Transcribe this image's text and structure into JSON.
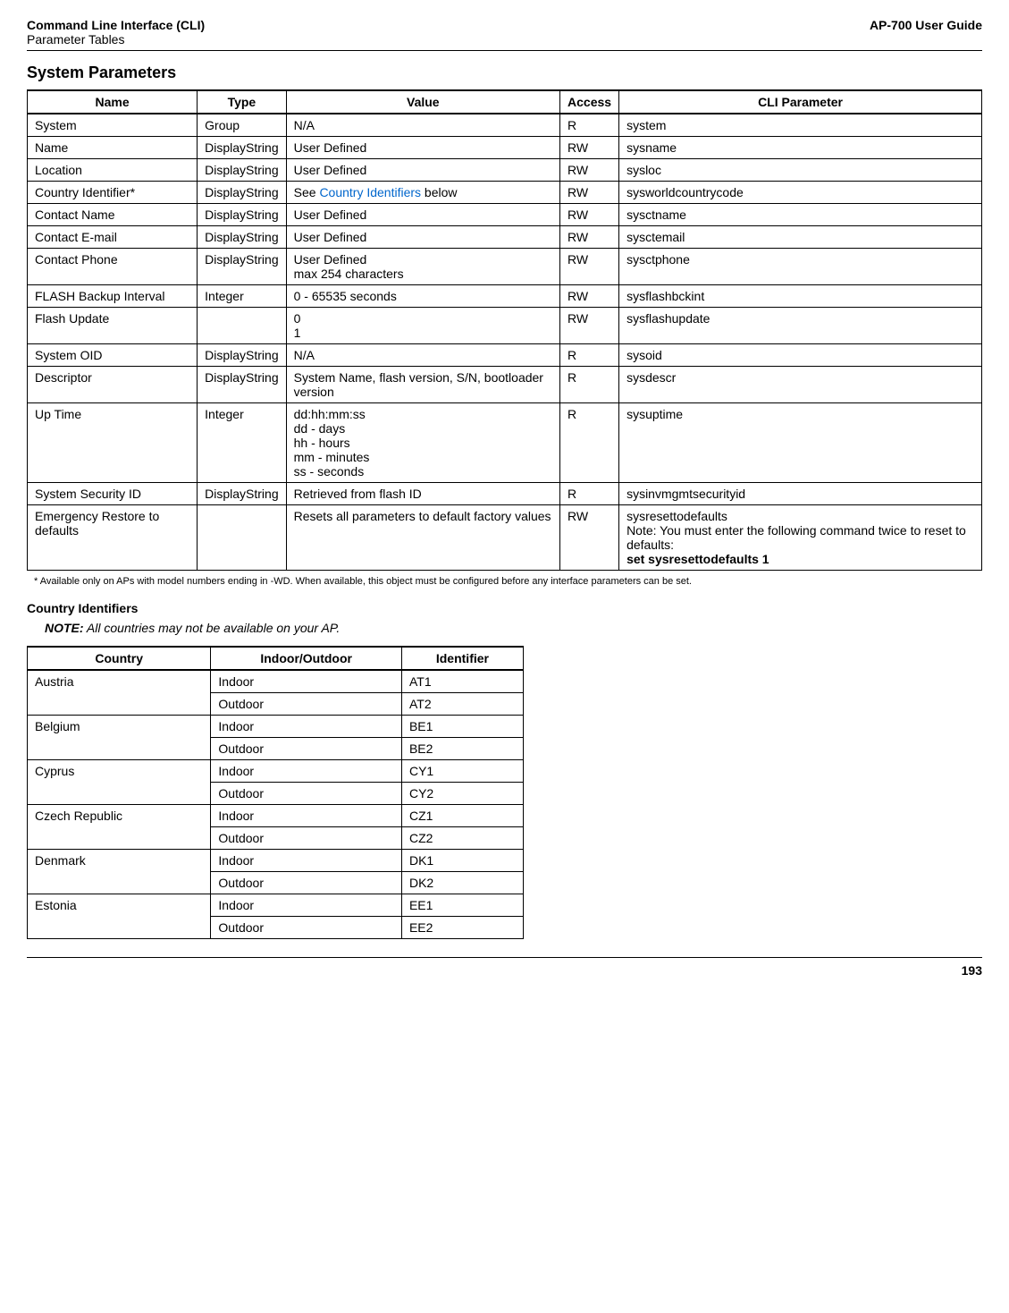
{
  "header": {
    "title": "Command Line Interface (CLI)",
    "subtitle": "Parameter Tables",
    "right": "AP-700 User Guide"
  },
  "section_title": "System Parameters",
  "sys_headers": {
    "name": "Name",
    "type": "Type",
    "value": "Value",
    "access": "Access",
    "cli": "CLI Parameter"
  },
  "sys_rows": {
    "r0": {
      "name": "System",
      "type": "Group",
      "value": "N/A",
      "access": "R",
      "cli": "system"
    },
    "r1": {
      "name": "Name",
      "type": "DisplayString",
      "value": "User Defined",
      "access": "RW",
      "cli": "sysname"
    },
    "r2": {
      "name": "Location",
      "type": "DisplayString",
      "value": "User Defined",
      "access": "RW",
      "cli": "sysloc"
    },
    "r3": {
      "name": "Country Identifier*",
      "type": "DisplayString",
      "value_pre": "See ",
      "value_link": "Country Identifiers",
      "value_post": " below",
      "access": "RW",
      "cli": "sysworldcountrycode"
    },
    "r4": {
      "name": "Contact Name",
      "type": "DisplayString",
      "value": "User Defined",
      "access": "RW",
      "cli": "sysctname"
    },
    "r5": {
      "name": "Contact E-mail",
      "type": "DisplayString",
      "value": "User Defined",
      "access": "RW",
      "cli": "sysctemail"
    },
    "r6": {
      "name": "Contact Phone",
      "type": "DisplayString",
      "value": "User Defined\nmax 254 characters",
      "access": "RW",
      "cli": "sysctphone"
    },
    "r7": {
      "name": "FLASH Backup Interval",
      "type": "Integer",
      "value": "0 - 65535 seconds",
      "access": "RW",
      "cli": "sysflashbckint"
    },
    "r8": {
      "name": "Flash Update",
      "type": "",
      "value": "0\n1",
      "access": "RW",
      "cli": "sysflashupdate"
    },
    "r9": {
      "name": "System OID",
      "type": "DisplayString",
      "value": "N/A",
      "access": "R",
      "cli": "sysoid"
    },
    "r10": {
      "name": "Descriptor",
      "type": "DisplayString",
      "value": "System Name, flash version, S/N, bootloader version",
      "access": "R",
      "cli": "sysdescr"
    },
    "r11": {
      "name": "Up Time",
      "type": "Integer",
      "value": "dd:hh:mm:ss\ndd - days\nhh - hours\nmm - minutes\nss - seconds",
      "access": "R",
      "cli": "sysuptime"
    },
    "r12": {
      "name": "System Security ID",
      "type": "DisplayString",
      "value": "Retrieved from flash ID",
      "access": "R",
      "cli": "sysinvmgmtsecurityid"
    },
    "r13": {
      "name": "Emergency Restore to defaults",
      "type": "",
      "value": "Resets all parameters to default factory values",
      "access": "RW",
      "cli_l1": "sysresettodefaults",
      "cli_l2": "Note: You must enter the following command twice to reset to defaults:",
      "cli_l3": "set sysresettodefaults 1"
    }
  },
  "footnote": "* Available only on APs with model numbers ending in -WD. When available, this object must be configured before any interface parameters can be set.",
  "subsection": "Country Identifiers",
  "note_label": "NOTE:",
  "note_text": " All countries may not be available on your AP.",
  "country_headers": {
    "country": "Country",
    "io": "Indoor/Outdoor",
    "id": "Identifier"
  },
  "countries": {
    "c0": {
      "name": "Austria",
      "io1": "Indoor",
      "id1": "AT1",
      "io2": "Outdoor",
      "id2": "AT2"
    },
    "c1": {
      "name": "Belgium",
      "io1": "Indoor",
      "id1": "BE1",
      "io2": "Outdoor",
      "id2": "BE2"
    },
    "c2": {
      "name": "Cyprus",
      "io1": "Indoor",
      "id1": "CY1",
      "io2": "Outdoor",
      "id2": "CY2"
    },
    "c3": {
      "name": "Czech Republic",
      "io1": "Indoor",
      "id1": "CZ1",
      "io2": "Outdoor",
      "id2": "CZ2"
    },
    "c4": {
      "name": "Denmark",
      "io1": "Indoor",
      "id1": "DK1",
      "io2": "Outdoor",
      "id2": "DK2"
    },
    "c5": {
      "name": "Estonia",
      "io1": "Indoor",
      "id1": "EE1",
      "io2": "Outdoor",
      "id2": "EE2"
    }
  },
  "page_number": "193"
}
